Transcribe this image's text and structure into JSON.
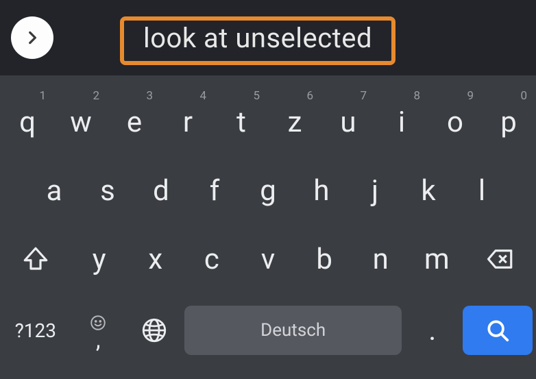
{
  "suggestion": {
    "primary": "look at unselected"
  },
  "keyboard": {
    "row1": [
      {
        "letter": "q",
        "hint": "1"
      },
      {
        "letter": "w",
        "hint": "2"
      },
      {
        "letter": "e",
        "hint": "3"
      },
      {
        "letter": "r",
        "hint": "4"
      },
      {
        "letter": "t",
        "hint": "5"
      },
      {
        "letter": "z",
        "hint": "6"
      },
      {
        "letter": "u",
        "hint": "7"
      },
      {
        "letter": "i",
        "hint": "8"
      },
      {
        "letter": "o",
        "hint": "9"
      },
      {
        "letter": "p",
        "hint": "0"
      }
    ],
    "row2": [
      {
        "letter": "a"
      },
      {
        "letter": "s"
      },
      {
        "letter": "d"
      },
      {
        "letter": "f"
      },
      {
        "letter": "g"
      },
      {
        "letter": "h"
      },
      {
        "letter": "j"
      },
      {
        "letter": "k"
      },
      {
        "letter": "l"
      }
    ],
    "row3": [
      {
        "letter": "y"
      },
      {
        "letter": "x"
      },
      {
        "letter": "c"
      },
      {
        "letter": "v"
      },
      {
        "letter": "b"
      },
      {
        "letter": "n"
      },
      {
        "letter": "m"
      }
    ],
    "symbols_label": "?123",
    "emoji_under": ",",
    "space_label": "Deutsch",
    "period": "."
  }
}
